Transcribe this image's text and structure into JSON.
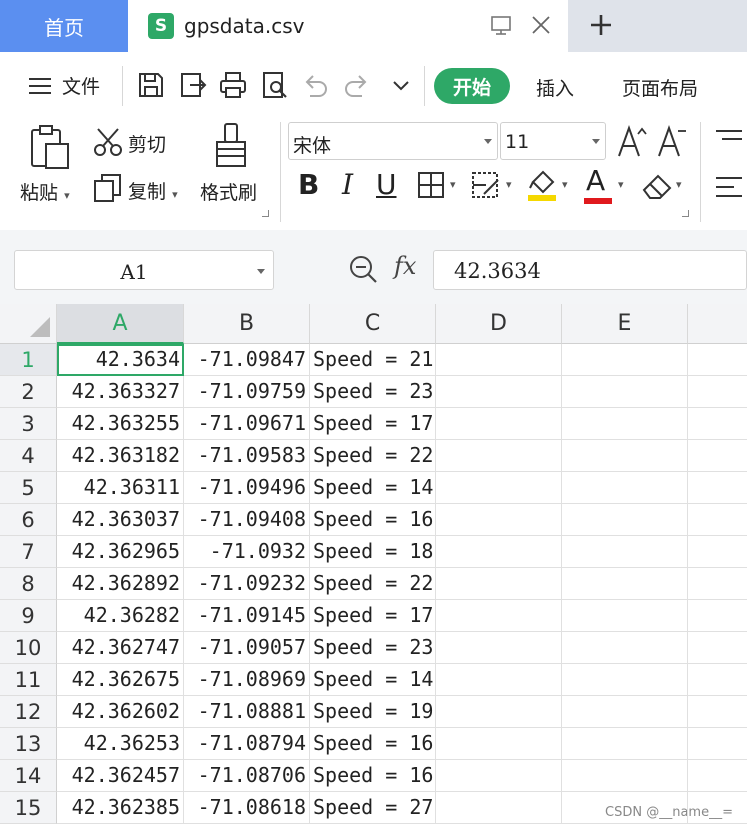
{
  "tabs": {
    "home_label": "首页",
    "file_icon_letter": "S",
    "file_name": "gpsdata.csv"
  },
  "menu": {
    "file_label": "文件",
    "start_label": "开始",
    "insert_label": "插入",
    "layout_label": "页面布局"
  },
  "ribbon": {
    "paste_label": "粘贴",
    "cut_label": "剪切",
    "copy_label": "复制",
    "format_painter_label": "格式刷",
    "font_name": "宋体",
    "font_size": "11",
    "bold_glyph": "B",
    "italic_glyph": "I",
    "underline_glyph": "U",
    "font_color_glyph": "A",
    "accent_color": "#2ea867",
    "highlight_color": "#f5d800",
    "font_color": "#e0191d"
  },
  "formula_bar": {
    "cell_ref": "A1",
    "fx_label": "fx",
    "value": "42.3634"
  },
  "sheet": {
    "columns": [
      "A",
      "B",
      "C",
      "D",
      "E"
    ],
    "rows": [
      {
        "n": "1",
        "a": "42.3634",
        "b": "-71.09847",
        "c": "Speed = 21"
      },
      {
        "n": "2",
        "a": "42.363327",
        "b": "-71.09759",
        "c": "Speed = 23"
      },
      {
        "n": "3",
        "a": "42.363255",
        "b": "-71.09671",
        "c": "Speed = 17"
      },
      {
        "n": "4",
        "a": "42.363182",
        "b": "-71.09583",
        "c": "Speed = 22"
      },
      {
        "n": "5",
        "a": "42.36311",
        "b": "-71.09496",
        "c": "Speed = 14"
      },
      {
        "n": "6",
        "a": "42.363037",
        "b": "-71.09408",
        "c": "Speed = 16"
      },
      {
        "n": "7",
        "a": "42.362965",
        "b": "-71.0932",
        "c": "Speed = 18"
      },
      {
        "n": "8",
        "a": "42.362892",
        "b": "-71.09232",
        "c": "Speed = 22"
      },
      {
        "n": "9",
        "a": "42.36282",
        "b": "-71.09145",
        "c": "Speed = 17"
      },
      {
        "n": "10",
        "a": "42.362747",
        "b": "-71.09057",
        "c": "Speed = 23"
      },
      {
        "n": "11",
        "a": "42.362675",
        "b": "-71.08969",
        "c": "Speed = 14"
      },
      {
        "n": "12",
        "a": "42.362602",
        "b": "-71.08881",
        "c": "Speed = 19"
      },
      {
        "n": "13",
        "a": "42.36253",
        "b": "-71.08794",
        "c": "Speed = 16"
      },
      {
        "n": "14",
        "a": "42.362457",
        "b": "-71.08706",
        "c": "Speed = 16"
      },
      {
        "n": "15",
        "a": "42.362385",
        "b": "-71.08618",
        "c": "Speed = 27"
      }
    ]
  },
  "watermark": "CSDN @__name__="
}
